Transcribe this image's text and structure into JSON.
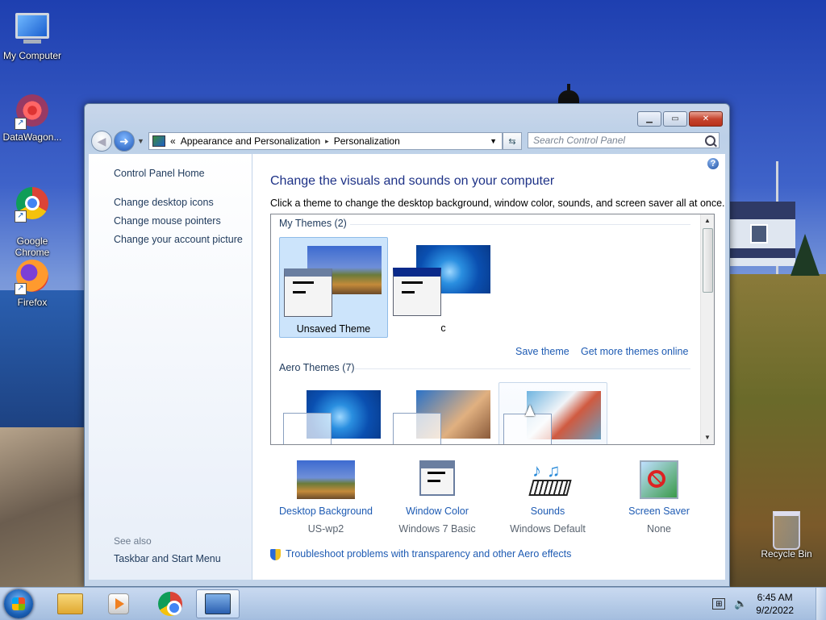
{
  "desktop": {
    "icons": [
      {
        "label": "My Computer",
        "icon": "computer-icon"
      },
      {
        "label": "DataWagon...",
        "icon": "datawagon-icon"
      },
      {
        "label": "Google\nChrome",
        "icon": "chrome-icon"
      },
      {
        "label": "Firefox",
        "icon": "firefox-icon"
      },
      {
        "label": "Recycle Bin",
        "icon": "recycle-bin-icon"
      }
    ]
  },
  "window": {
    "breadcrumb": {
      "prefix": "«",
      "items": [
        "Appearance and Personalization",
        "Personalization"
      ],
      "separator": "▸"
    },
    "search_placeholder": "Search Control Panel",
    "left_nav": {
      "home": "Control Panel Home",
      "links": [
        "Change desktop icons",
        "Change mouse pointers",
        "Change your account picture"
      ],
      "see_also_heading": "See also",
      "see_also": [
        "Taskbar and Start Menu"
      ]
    },
    "main": {
      "title": "Change the visuals and sounds on your computer",
      "subtitle": "Click a theme to change the desktop background, window color, sounds, and screen saver all at once.",
      "my_themes_heading": "My Themes (2)",
      "my_themes": [
        {
          "label": "Unsaved Theme",
          "selected": true
        },
        {
          "label": "c",
          "selected": false
        }
      ],
      "save_theme": "Save theme",
      "get_more": "Get more themes online",
      "aero_themes_heading": "Aero Themes (7)",
      "bottom": {
        "desktop_background": {
          "label": "Desktop Background",
          "value": "US-wp2"
        },
        "window_color": {
          "label": "Window Color",
          "value": "Windows 7 Basic"
        },
        "sounds": {
          "label": "Sounds",
          "value": "Windows Default"
        },
        "screen_saver": {
          "label": "Screen Saver",
          "value": "None"
        }
      },
      "troubleshoot": "Troubleshoot problems with transparency and other Aero effects"
    }
  },
  "taskbar": {
    "time": "6:45 AM",
    "date": "9/2/2022"
  }
}
